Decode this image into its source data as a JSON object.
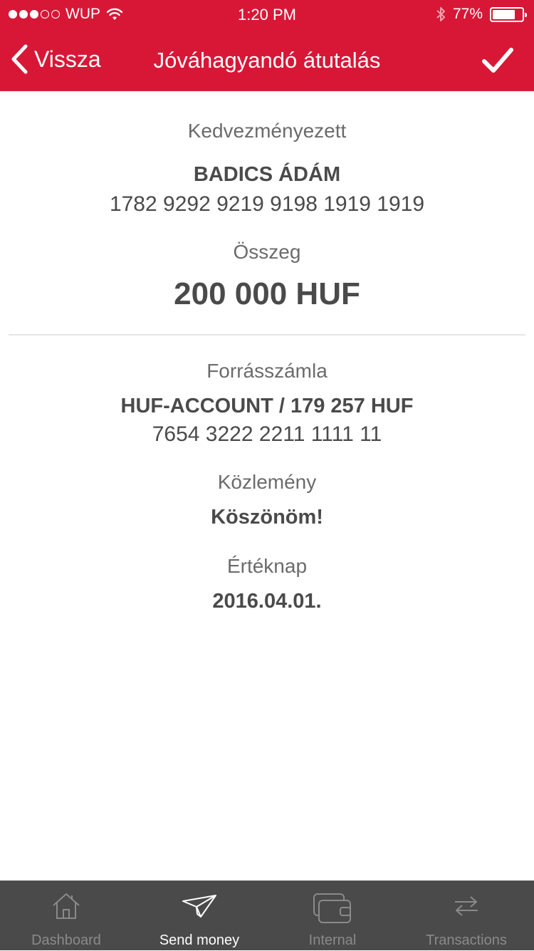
{
  "status_bar": {
    "carrier": "WUP",
    "time": "1:20 PM",
    "battery": "77%",
    "battery_level": 0.77
  },
  "nav": {
    "back_label": "Vissza",
    "title": "Jóváhagyandó átutalás",
    "confirm_icon": "checkmark-icon"
  },
  "beneficiary": {
    "label": "Kedvezményezett",
    "name": "BADICS ÁDÁM",
    "account": "1782 9292 9219 9198 1919 1919"
  },
  "amount": {
    "label": "Összeg",
    "value": "200 000 HUF"
  },
  "source": {
    "label": "Forrásszámla",
    "account_name": "HUF-ACCOUNT / 179 257 HUF",
    "account_number": "7654 3222 2211 1111 11"
  },
  "note": {
    "label": "Közlemény",
    "value": "Köszönöm!"
  },
  "value_date": {
    "label": "Értéknap",
    "value": "2016.04.01."
  },
  "tabs": [
    {
      "label": "Dashboard",
      "icon": "home-icon",
      "active": false
    },
    {
      "label": "Send money",
      "icon": "paper-plane-icon",
      "active": true
    },
    {
      "label": "Internal",
      "icon": "wallet-icon",
      "active": false
    },
    {
      "label": "Transactions",
      "icon": "transfer-arrows-icon",
      "active": false
    }
  ],
  "colors": {
    "brand_red": "#d81736",
    "tabbar_bg": "#4a4a4a",
    "text_dark": "#4a4a4a",
    "text_label": "#6b6b6b"
  }
}
